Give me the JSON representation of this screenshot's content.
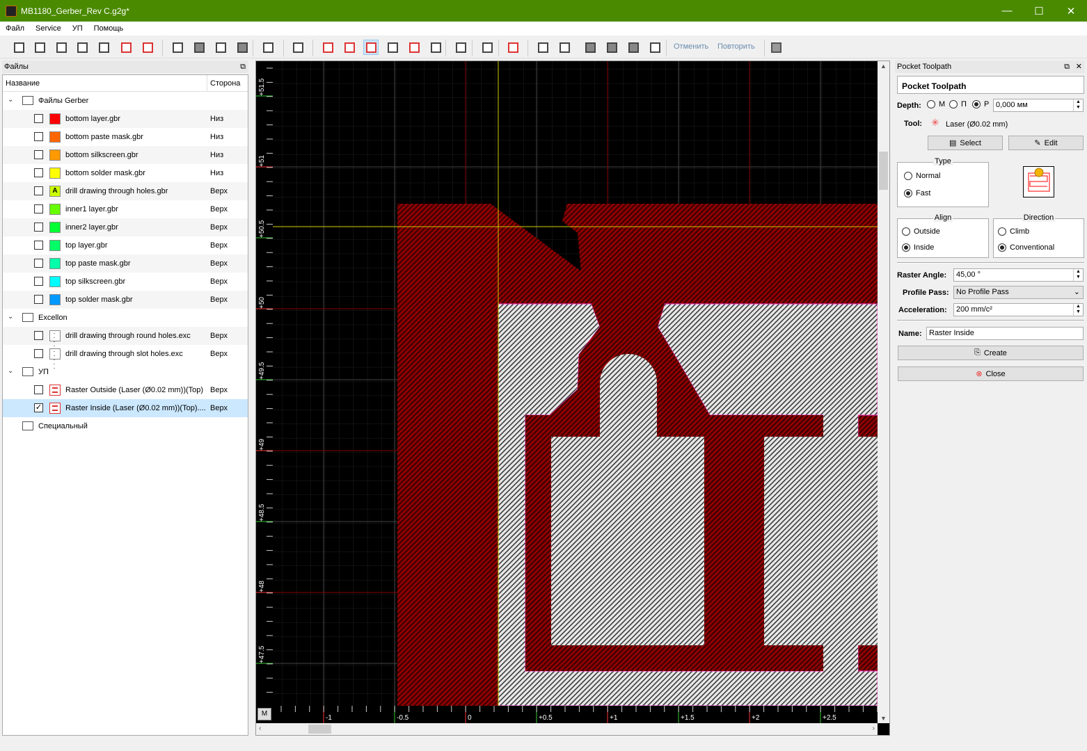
{
  "window": {
    "title": "MB1180_Gerber_Rev C.g2g*",
    "minimize": "—",
    "maximize": "☐",
    "close": "✕"
  },
  "menu": [
    "Файл",
    "Service",
    "УП",
    "Помощь"
  ],
  "toolbar": {
    "undo": "Отменить",
    "redo": "Повторить"
  },
  "files_panel": {
    "title": "Файлы",
    "col_name": "Название",
    "col_side": "Сторона",
    "groups": [
      {
        "label": "Файлы Gerber",
        "items": [
          {
            "name": "bottom layer.gbr",
            "side": "Низ",
            "color": "#ff0000",
            "checked": false
          },
          {
            "name": "bottom paste mask.gbr",
            "side": "Низ",
            "color": "#ff6600",
            "checked": false
          },
          {
            "name": "bottom silkscreen.gbr",
            "side": "Низ",
            "color": "#ff9900",
            "checked": false
          },
          {
            "name": "bottom solder mask.gbr",
            "side": "Низ",
            "color": "#ffff00",
            "checked": false
          },
          {
            "name": "drill drawing through holes.gbr",
            "side": "Верх",
            "color": "#ccff00",
            "glyph": "A",
            "checked": false
          },
          {
            "name": "inner1 layer.gbr",
            "side": "Верх",
            "color": "#66ff00",
            "checked": false
          },
          {
            "name": "inner2 layer.gbr",
            "side": "Верх",
            "color": "#00ff33",
            "checked": false
          },
          {
            "name": "top layer.gbr",
            "side": "Верх",
            "color": "#00ff66",
            "checked": false
          },
          {
            "name": "top paste mask.gbr",
            "side": "Верх",
            "color": "#00ffaa",
            "checked": false
          },
          {
            "name": "top silkscreen.gbr",
            "side": "Верх",
            "color": "#00ffff",
            "checked": false
          },
          {
            "name": "top solder mask.gbr",
            "side": "Верх",
            "color": "#0099ff",
            "checked": false
          }
        ]
      },
      {
        "label": "Excellon",
        "items": [
          {
            "name": "drill drawing through round holes.exc",
            "side": "Верх",
            "icon": "drill-icon",
            "checked": false
          },
          {
            "name": "drill drawing through slot holes.exc",
            "side": "Верх",
            "icon": "drill-icon",
            "checked": false
          }
        ]
      },
      {
        "label": "УП",
        "items": [
          {
            "name": "Raster Outside (Laser (Ø0.02 mm))(Top)",
            "side": "Верх",
            "icon": "toolpath-icon",
            "checked": false
          },
          {
            "name": "Raster Inside (Laser (Ø0.02 mm))(Top)....",
            "side": "Верх",
            "icon": "toolpath-icon",
            "checked": true,
            "selected": true
          }
        ]
      },
      {
        "label": "Специальный",
        "items": []
      }
    ]
  },
  "canvas": {
    "units_button": "M",
    "y_ticks": [
      "+51.5",
      "+51",
      "+50.5",
      "+50",
      "+49.5",
      "+49",
      "+48.5",
      "+48",
      "+47.5"
    ],
    "x_ticks": [
      "-1",
      "-0.5",
      "0",
      "+0.5",
      "+1",
      "+1.5",
      "+2",
      "+2.5"
    ]
  },
  "pocket": {
    "panel_title": "Pocket Toolpath",
    "heading": "Pocket Toolpath",
    "depth_label": "Depth:",
    "depth_options": [
      "М",
      "П",
      "Р"
    ],
    "depth_selected": "Р",
    "depth_value": "0,000 мм",
    "tool_label": "Tool:",
    "tool_value": "Laser (Ø0.02 mm)",
    "select_btn": "Select",
    "edit_btn": "Edit",
    "type_title": "Type",
    "type_options": [
      "Normal",
      "Fast"
    ],
    "type_selected": "Fast",
    "align_title": "Align",
    "align_options": [
      "Outside",
      "Inside"
    ],
    "align_selected": "Inside",
    "direction_title": "Direction",
    "direction_options": [
      "Climb",
      "Conventional"
    ],
    "direction_selected": "Conventional",
    "raster_angle_label": "Raster Angle:",
    "raster_angle": "45,00 °",
    "profile_label": "Profile Pass:",
    "profile_value": "No Profile Pass",
    "accel_label": "Acceleration:",
    "accel_value": "200 mm/c²",
    "name_label": "Name:",
    "name_value": "Raster Inside",
    "create_btn": "Create",
    "close_btn": "Close"
  }
}
